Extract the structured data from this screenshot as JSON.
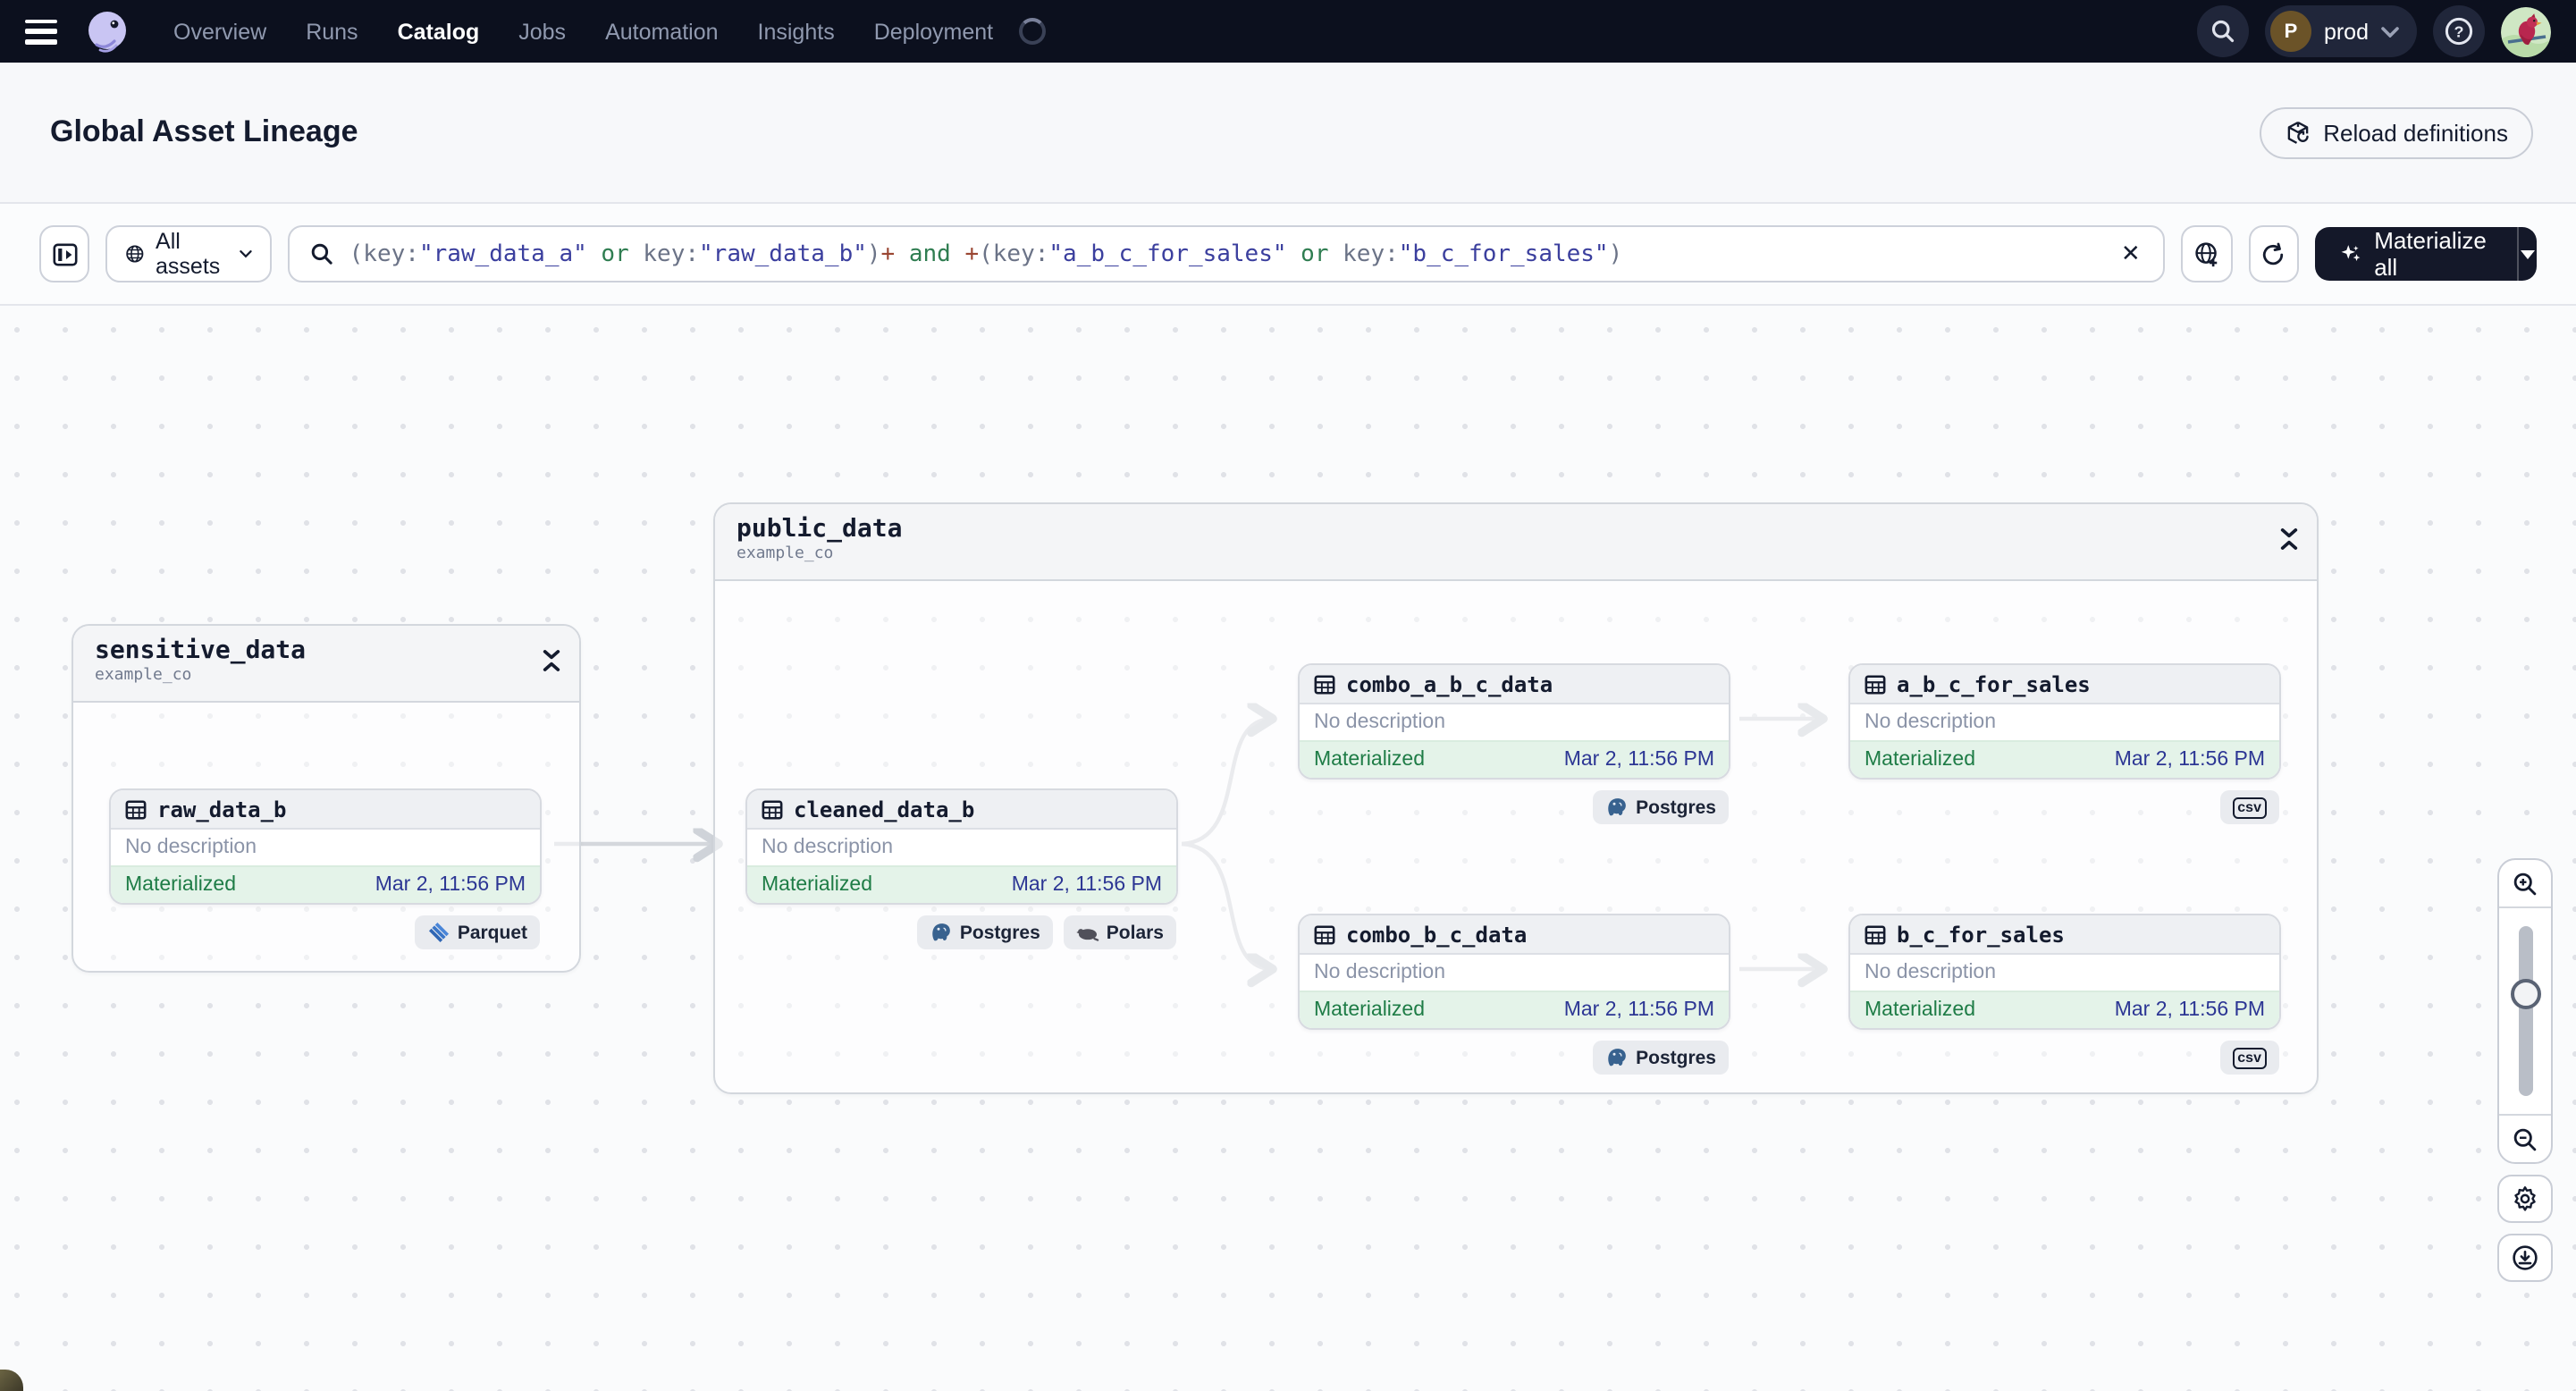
{
  "nav": {
    "menu_items": [
      "Overview",
      "Runs",
      "Catalog",
      "Jobs",
      "Automation",
      "Insights",
      "Deployment"
    ],
    "active_item": "Catalog",
    "deployment_switcher": {
      "initial": "P",
      "label": "prod"
    }
  },
  "header": {
    "title": "Global Asset Lineage",
    "reload_button_label": "Reload definitions"
  },
  "toolbar": {
    "scope_button_label": "All assets",
    "materialize_button_label": "Materialize all",
    "query": {
      "full_text": "(key:\"raw_data_a\" or key:\"raw_data_b\")+ and +(key:\"a_b_c_for_sales\" or key:\"b_c_for_sales\")",
      "segments": [
        {
          "text": "(key:",
          "type": "punct"
        },
        {
          "text": "\"raw_data_a\"",
          "type": "string"
        },
        {
          "text": " or ",
          "type": "op"
        },
        {
          "text": "key:",
          "type": "punct"
        },
        {
          "text": "\"raw_data_b\"",
          "type": "string"
        },
        {
          "text": ")",
          "type": "punct"
        },
        {
          "text": "+",
          "type": "plus"
        },
        {
          "text": " and ",
          "type": "op"
        },
        {
          "text": "+",
          "type": "plus"
        },
        {
          "text": "(key:",
          "type": "punct"
        },
        {
          "text": "\"a_b_c_for_sales\"",
          "type": "string"
        },
        {
          "text": " or ",
          "type": "op"
        },
        {
          "text": "key:",
          "type": "punct"
        },
        {
          "text": "\"b_c_for_sales\"",
          "type": "string"
        },
        {
          "text": ")",
          "type": "punct"
        }
      ]
    }
  },
  "graph": {
    "groups": [
      {
        "name": "sensitive_data",
        "location": "example_co"
      },
      {
        "name": "public_data",
        "location": "example_co"
      }
    ],
    "nodes": [
      {
        "name": "raw_data_b",
        "description": "No description",
        "status": "Materialized",
        "materialized_at": "Mar 2, 11:56 PM",
        "tags": [
          {
            "label": "Parquet",
            "icon": "parquet-icon"
          }
        ]
      },
      {
        "name": "cleaned_data_b",
        "description": "No description",
        "status": "Materialized",
        "materialized_at": "Mar 2, 11:56 PM",
        "tags": [
          {
            "label": "Postgres",
            "icon": "postgres-icon"
          },
          {
            "label": "Polars",
            "icon": "polars-icon"
          }
        ]
      },
      {
        "name": "combo_a_b_c_data",
        "description": "No description",
        "status": "Materialized",
        "materialized_at": "Mar 2, 11:56 PM",
        "tags": [
          {
            "label": "Postgres",
            "icon": "postgres-icon"
          }
        ]
      },
      {
        "name": "a_b_c_for_sales",
        "description": "No description",
        "status": "Materialized",
        "materialized_at": "Mar 2, 11:56 PM",
        "tags": [
          {
            "label": "csv",
            "icon": "csv-icon"
          }
        ]
      },
      {
        "name": "combo_b_c_data",
        "description": "No description",
        "status": "Materialized",
        "materialized_at": "Mar 2, 11:56 PM",
        "tags": [
          {
            "label": "Postgres",
            "icon": "postgres-icon"
          }
        ]
      },
      {
        "name": "b_c_for_sales",
        "description": "No description",
        "status": "Materialized",
        "materialized_at": "Mar 2, 11:56 PM",
        "tags": [
          {
            "label": "csv",
            "icon": "csv-icon"
          }
        ]
      }
    ]
  },
  "colors": {
    "topnav_bg": "#0c101e",
    "materialize_button_bg": "#141829",
    "status_materialized_bg": "#e4f3e9",
    "status_materialized_text": "#1e7c46",
    "timestamp_text": "#2c3694",
    "query_string": "#3b3f9e",
    "query_operator": "#2f7d51",
    "query_plus": "#9a4632",
    "edge": "#d4d7dc"
  }
}
